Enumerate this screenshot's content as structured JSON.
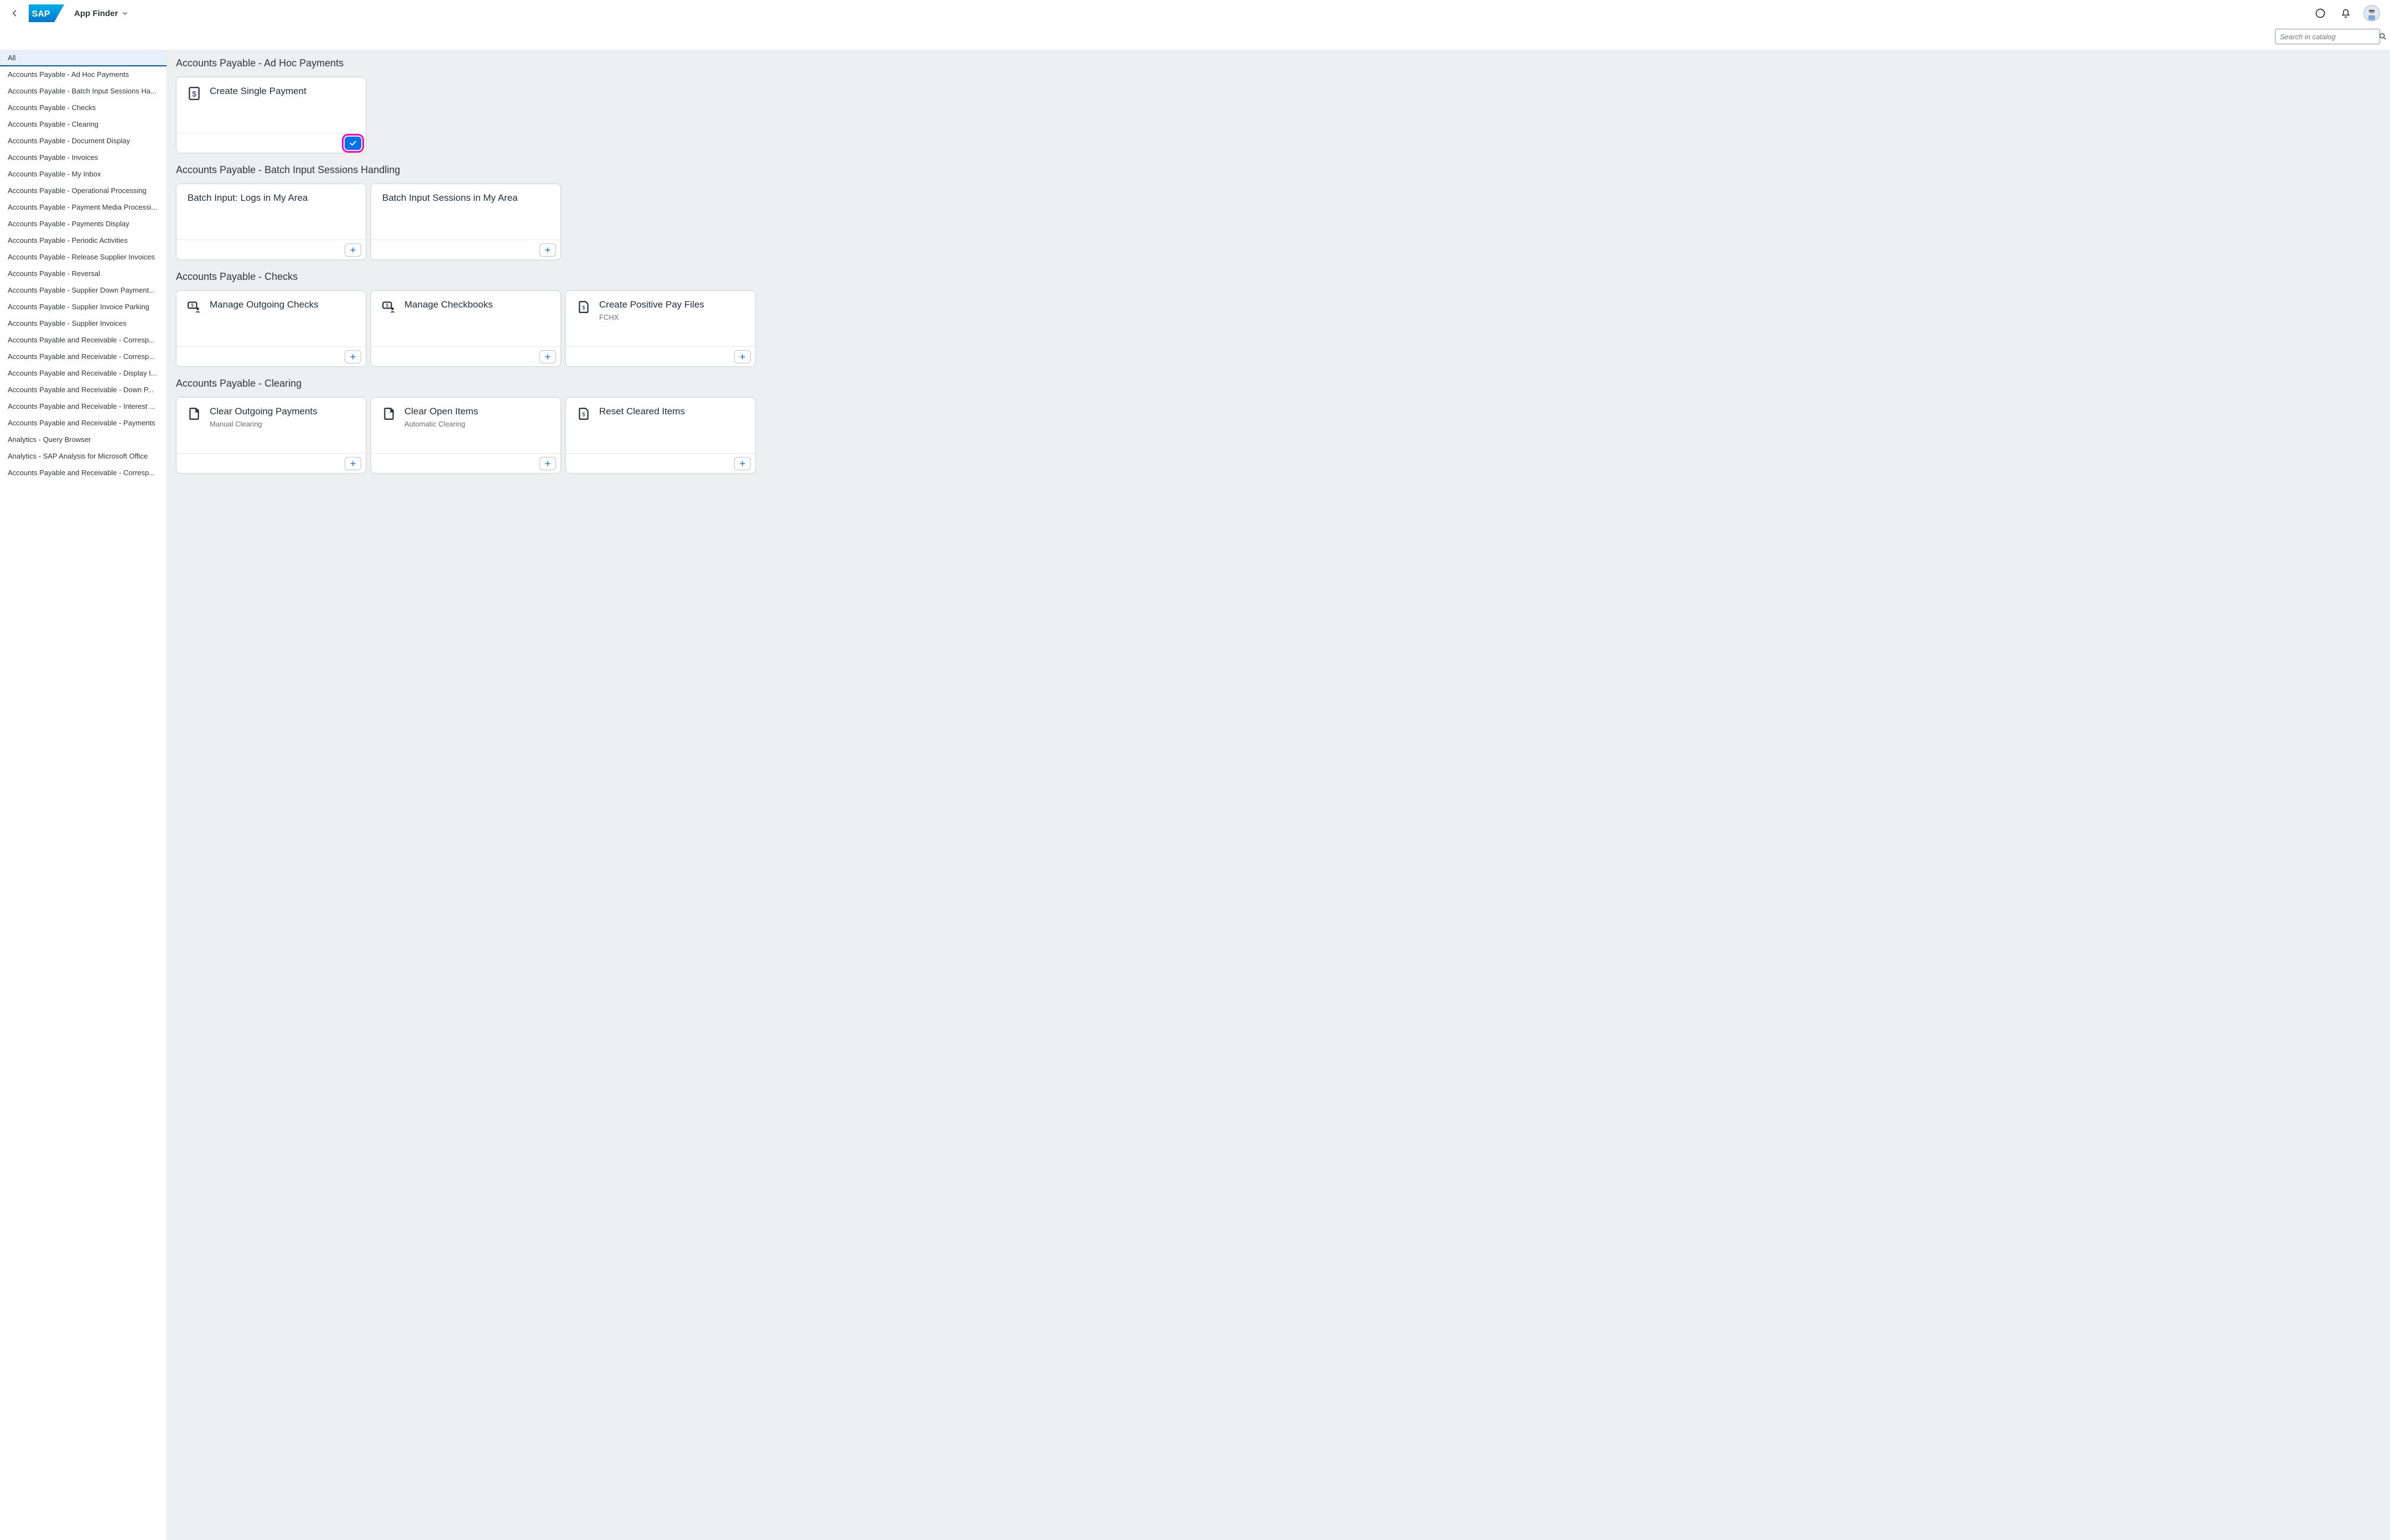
{
  "header": {
    "title": "App Finder",
    "logo_text": "SAP"
  },
  "search": {
    "placeholder": "Search in catalog"
  },
  "sidebar": {
    "items": [
      {
        "label": "All",
        "selected": true
      },
      {
        "label": "Accounts Payable - Ad Hoc Payments"
      },
      {
        "label": "Accounts Payable - Batch Input Sessions Ha..."
      },
      {
        "label": "Accounts Payable - Checks"
      },
      {
        "label": "Accounts Payable - Clearing"
      },
      {
        "label": "Accounts Payable - Document Display"
      },
      {
        "label": "Accounts Payable - Invoices"
      },
      {
        "label": "Accounts Payable - My Inbox"
      },
      {
        "label": "Accounts Payable - Operational Processing"
      },
      {
        "label": "Accounts Payable - Payment Media Processi..."
      },
      {
        "label": "Accounts Payable - Payments Display"
      },
      {
        "label": "Accounts Payable - Periodic Activities"
      },
      {
        "label": "Accounts Payable - Release Supplier Invoices"
      },
      {
        "label": "Accounts Payable - Reversal"
      },
      {
        "label": "Accounts Payable - Supplier Down Payment..."
      },
      {
        "label": "Accounts Payable - Supplier Invoice Parking"
      },
      {
        "label": "Accounts Payable - Supplier Invoices"
      },
      {
        "label": "Accounts Payable and Receivable - Corresp..."
      },
      {
        "label": "Accounts Payable and Receivable - Corresp..."
      },
      {
        "label": "Accounts Payable and Receivable - Display I..."
      },
      {
        "label": "Accounts Payable and Receivable - Down P..."
      },
      {
        "label": "Accounts Payable and Receivable - Interest ..."
      },
      {
        "label": "Accounts Payable and Receivable - Payments"
      },
      {
        "label": "Analytics - Query Browser"
      },
      {
        "label": "Analytics - SAP Analysis for Microsoft Office"
      },
      {
        "label": "Accounts Payable and Receivable - Corresp..."
      }
    ]
  },
  "sections": [
    {
      "title": "Accounts Payable - Ad Hoc Payments",
      "tiles": [
        {
          "icon": "dollar-doc",
          "title": "Create Single Payment",
          "pinned": true,
          "highlight": true
        }
      ]
    },
    {
      "title": "Accounts Payable - Batch Input Sessions Handling",
      "tiles": [
        {
          "title": "Batch Input: Logs in My Area",
          "pinned": false
        },
        {
          "title": "Batch Input Sessions in My Area",
          "pinned": false
        }
      ]
    },
    {
      "title": "Accounts Payable - Checks",
      "tiles": [
        {
          "icon": "money-people",
          "title": "Manage Outgoing Checks",
          "pinned": false
        },
        {
          "icon": "money-people",
          "title": "Manage Checkbooks",
          "pinned": false
        },
        {
          "icon": "money-doc",
          "title": "Create Positive Pay Files",
          "subtitle": "FCHX",
          "pinned": false
        }
      ]
    },
    {
      "title": "Accounts Payable - Clearing",
      "tiles": [
        {
          "icon": "doc-x",
          "title": "Clear Outgoing Payments",
          "subtitle": "Manual Clearing",
          "pinned": false
        },
        {
          "icon": "doc-x",
          "title": "Clear Open Items",
          "subtitle": "Automatic Clearing",
          "pinned": false
        },
        {
          "icon": "money-doc",
          "title": "Reset Cleared Items",
          "pinned": false
        }
      ]
    }
  ]
}
